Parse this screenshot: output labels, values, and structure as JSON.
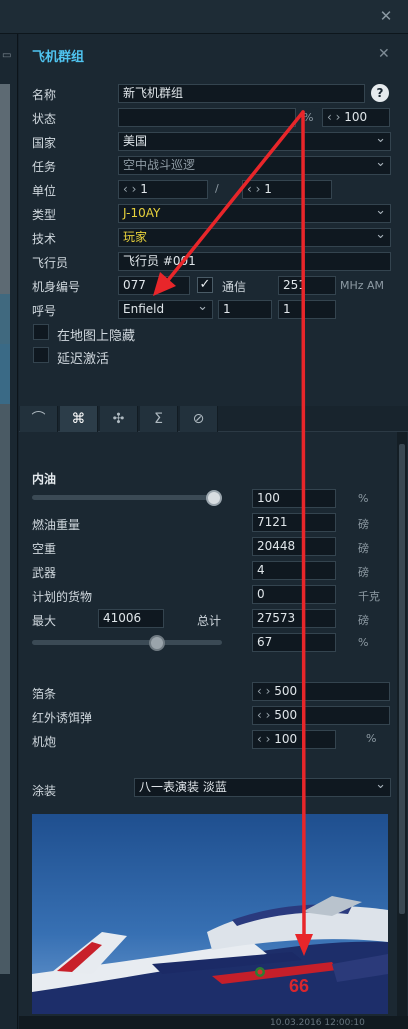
{
  "topbar": {
    "close_icon": "close-icon"
  },
  "dialog": {
    "title": "飞机群组",
    "close_icon": "close-icon"
  },
  "form": {
    "name": {
      "label": "名称",
      "value": "新飞机群组"
    },
    "help_icon": "?",
    "status": {
      "label": "状态",
      "value": "",
      "unit": "%",
      "stepper": "100"
    },
    "country": {
      "label": "国家",
      "value": "美国"
    },
    "task": {
      "label": "任务",
      "value": "空中战斗巡逻"
    },
    "unit": {
      "label": "单位",
      "left": "1",
      "slash": "/",
      "right": "1"
    },
    "type": {
      "label": "类型",
      "value": "J-10AY"
    },
    "skill": {
      "label": "技术",
      "value": "玩家"
    },
    "pilot": {
      "label": "飞行员",
      "value": "飞行员 #001"
    },
    "tail": {
      "label": "机身编号",
      "value": "077",
      "comm_label": "通信",
      "freq": "251",
      "freq_unit": "MHz AM"
    },
    "callsign": {
      "label": "呼号",
      "value": "Enfield",
      "n1": "1",
      "n2": "1"
    },
    "hide_on_map": {
      "label": "在地图上隐藏",
      "checked": false
    },
    "late_activation": {
      "label": "延迟激活",
      "checked": false
    }
  },
  "tabs": [
    {
      "icon": "route-icon",
      "glyph": "⌒"
    },
    {
      "icon": "payload-icon",
      "glyph": "⌘"
    },
    {
      "icon": "drone-icon",
      "glyph": "✣"
    },
    {
      "icon": "summary-icon",
      "glyph": "Σ"
    },
    {
      "icon": "forbidden-icon",
      "glyph": "⊘"
    }
  ],
  "fuel": {
    "section_title": "内油",
    "slider_percent": 100,
    "percent_value": "100",
    "percent_unit": "%",
    "fuel_weight": {
      "label": "燃油重量",
      "value": "7121",
      "unit": "磅"
    },
    "empty_weight": {
      "label": "空重",
      "value": "20448",
      "unit": "磅"
    },
    "weapons": {
      "label": "武器",
      "value": "4",
      "unit": "磅"
    },
    "cargo": {
      "label": "计划的货物",
      "value": "0",
      "unit": "千克"
    },
    "max": {
      "label": "最大",
      "value": "41006",
      "total_label": "总计",
      "total_value": "27573",
      "unit": "磅"
    },
    "load_slider_percent": 67,
    "load_percent": "67",
    "load_unit": "%"
  },
  "countermeasures": {
    "chaff": {
      "label": "箔条",
      "value": "500"
    },
    "flare": {
      "label": "红外诱饵弹",
      "value": "500"
    },
    "gun": {
      "label": "机炮",
      "value": "100",
      "unit": "%"
    }
  },
  "livery": {
    "label": "涂装",
    "value": "八一表演装 淡蓝",
    "tail_number_on_image": "66"
  },
  "footer": {
    "text": "10.03.2016 12:00:10"
  },
  "colors": {
    "accent": "#4fc4f0",
    "annotation": "#e8262a",
    "type_yellow": "#e8d23c"
  }
}
